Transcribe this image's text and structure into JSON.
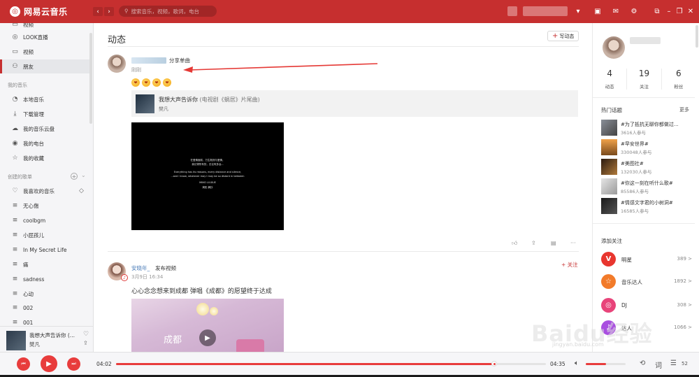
{
  "app": {
    "title": "网易云音乐",
    "logo_icon": "netease-cloud-music-logo"
  },
  "titlebar": {
    "back": "‹",
    "forward": "›",
    "search_placeholder": "搜索音乐，视频，歌词，电台"
  },
  "sidebar": {
    "partial_top": "视频",
    "items_top": [
      {
        "label": "LOOK直播",
        "icon": "live-icon"
      },
      {
        "label": "视频",
        "icon": "video-icon"
      },
      {
        "label": "朋友",
        "icon": "friends-icon",
        "active": true
      }
    ],
    "my_music_title": "我的音乐",
    "my_music": [
      {
        "label": "本地音乐",
        "icon": "local-music-icon"
      },
      {
        "label": "下载管理",
        "icon": "download-icon"
      },
      {
        "label": "我的音乐云盘",
        "icon": "cloud-icon"
      },
      {
        "label": "我的电台",
        "icon": "radio-icon"
      },
      {
        "label": "我的收藏",
        "icon": "collection-icon"
      }
    ],
    "created_title": "创建的歌单",
    "playlists": [
      {
        "label": "我喜欢的音乐",
        "icon": "heart-icon"
      },
      {
        "label": "无心傷",
        "icon": "playlist-icon"
      },
      {
        "label": "coolbgm",
        "icon": "playlist-icon"
      },
      {
        "label": "小屁孩儿",
        "icon": "playlist-icon"
      },
      {
        "label": "In My Secret Life",
        "icon": "playlist-icon"
      },
      {
        "label": "痛",
        "icon": "playlist-icon"
      },
      {
        "label": "sadness",
        "icon": "playlist-icon"
      },
      {
        "label": "心动",
        "icon": "playlist-icon"
      },
      {
        "label": "002",
        "icon": "playlist-icon"
      },
      {
        "label": "001",
        "icon": "playlist-icon"
      }
    ]
  },
  "now_playing": {
    "title": "我想大声告诉你 (...",
    "artist": "樊凡"
  },
  "main": {
    "title": "动态",
    "write_button": "写动态",
    "post1": {
      "action": "分享单曲",
      "time": "刚刚",
      "song_title": "我想大声告诉你",
      "song_subtitle": "(电视剧《蜗居》片尾曲)",
      "song_artist": "樊凡",
      "video_lines": [
        "在爱情面前，万生既然与爱情，",
        "我记得所有的，无论有多远...",
        "Everything has its reasons, every distance and silence,",
        "...and I know, whatever may I may be so distant in between",
        "MIIKO LIUXUE",
        "简拓 摘抄"
      ]
    },
    "post2": {
      "user": "安晓年_",
      "action": "发布视频",
      "time": "3月9日 16:34",
      "follow": "+ 关注",
      "text": "心心念念想来到成都 弹唱《成都》的愿望终于达成",
      "video_label": "成都"
    }
  },
  "right_panel": {
    "stats": [
      {
        "value": "4",
        "label": "动态"
      },
      {
        "value": "19",
        "label": "关注"
      },
      {
        "value": "6",
        "label": "粉丝"
      }
    ],
    "hot_topics_title": "热门话题",
    "more": "更多",
    "topics": [
      {
        "name": "#为了抵抗无聊你都做过...",
        "count": "3616人参与"
      },
      {
        "name": "#早安世界#",
        "count": "330048人参与"
      },
      {
        "name": "#美图社#",
        "count": "132030人参与"
      },
      {
        "name": "#你这一刻在听什么歌#",
        "count": "85586人参与"
      },
      {
        "name": "#情感文字君的小树洞#",
        "count": "16585人参与"
      }
    ],
    "add_follow_title": "添加关注",
    "recommendations": [
      {
        "name": "明星",
        "count": "389 >",
        "color": "#e8362f",
        "glyph": "V"
      },
      {
        "name": "音乐达人",
        "count": "1892 >",
        "color": "#f27b2a",
        "glyph": "☆"
      },
      {
        "name": "DJ",
        "count": "308 >",
        "color": "#e8447a",
        "glyph": "◎"
      },
      {
        "name": "达人",
        "count": "1066 >",
        "color": "#a94fe0",
        "glyph": "♪"
      }
    ]
  },
  "player": {
    "current_time": "04:02",
    "total_time": "04:35",
    "progress": 0.879,
    "volume": 0.5,
    "playlist_count": "52"
  },
  "watermark": {
    "brand": "Baidu经验",
    "url": "jingyan.baidu.com"
  },
  "colors": {
    "accent": "#c62f2f",
    "play_red": "#e83c3c",
    "arrow": "#e53935"
  }
}
